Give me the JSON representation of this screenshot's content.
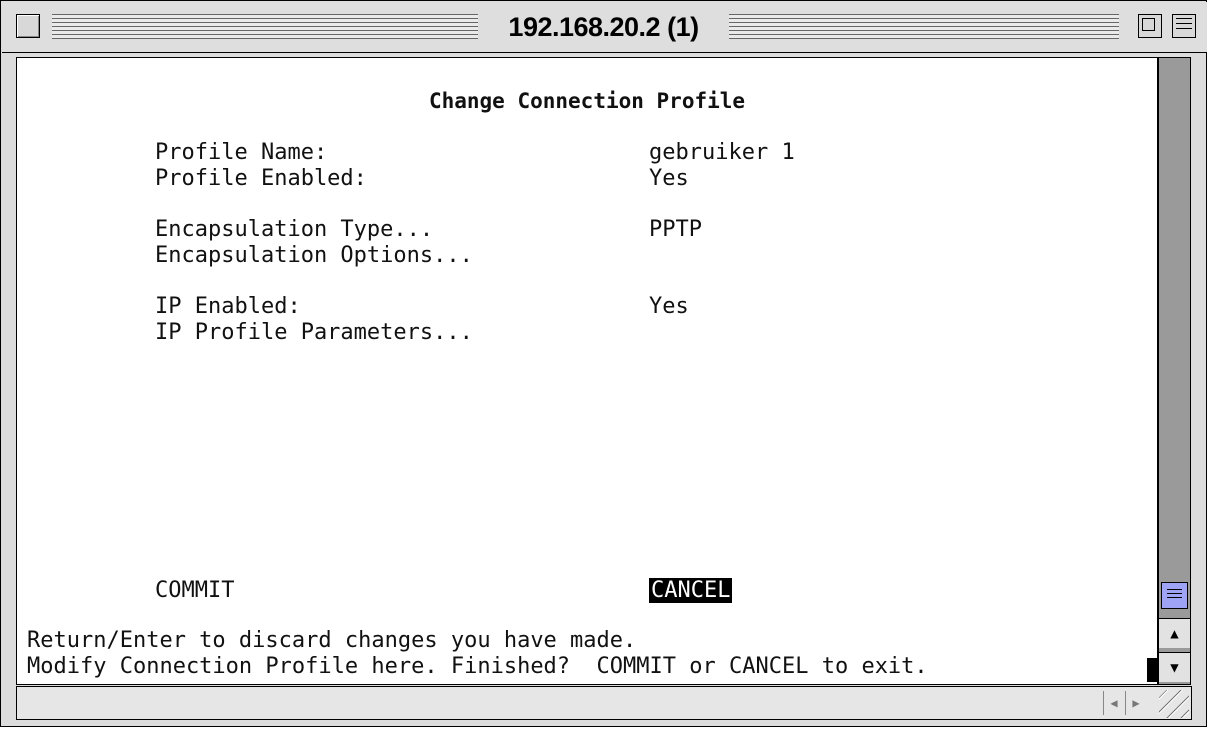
{
  "window": {
    "title": "192.168.20.2 (1)"
  },
  "screen": {
    "heading": "Change Connection Profile",
    "rows": [
      {
        "label": "Profile Name:",
        "value": "gebruiker 1"
      },
      {
        "label": "Profile Enabled:",
        "value": "Yes"
      },
      {
        "label": "Encapsulation Type...",
        "value": "PPTP"
      },
      {
        "label": "Encapsulation Options...",
        "value": ""
      },
      {
        "label": "IP Enabled:",
        "value": "Yes"
      },
      {
        "label": "IP Profile Parameters...",
        "value": ""
      }
    ],
    "commit_label": "COMMIT",
    "cancel_label": "CANCEL",
    "status_line_1": "Return/Enter to discard changes you have made.",
    "status_line_2": "Modify Connection Profile here. Finished?  COMMIT or CANCEL to exit."
  },
  "icons": {
    "close": "close-box-icon",
    "zoom": "zoom-box-icon",
    "collapse": "collapse-box-icon",
    "scroll_up": "up-arrow-icon",
    "scroll_down": "down-arrow-icon",
    "scroll_left": "left-arrow-icon",
    "scroll_right": "right-arrow-icon",
    "resize": "grow-box-icon"
  },
  "colors": {
    "scroll_thumb": "#9fa3f5",
    "selection_bg": "#000000",
    "selection_fg": "#ffffff"
  }
}
